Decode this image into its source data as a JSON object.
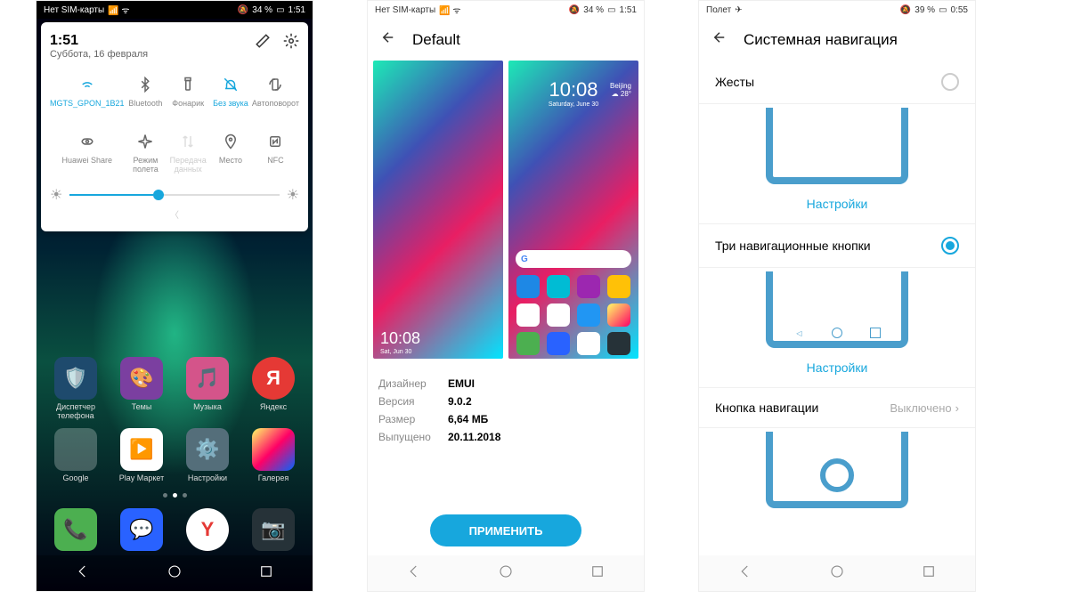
{
  "phone1": {
    "status": {
      "left": "Нет SIM-карты",
      "battery": "34 %",
      "time": "1:51"
    },
    "qs": {
      "time": "1:51",
      "date": "Суббота, 16 февраля",
      "tiles": [
        {
          "label": "MGTS_GPON_1B21",
          "state": "active"
        },
        {
          "label": "Bluetooth",
          "state": ""
        },
        {
          "label": "Фонарик",
          "state": ""
        },
        {
          "label": "Без звука",
          "state": "active"
        },
        {
          "label": "Автоповорот",
          "state": ""
        },
        {
          "label": "Huawei Share",
          "state": ""
        },
        {
          "label": "Режим полета",
          "state": ""
        },
        {
          "label": "Передача данных",
          "state": "dis"
        },
        {
          "label": "Место",
          "state": ""
        },
        {
          "label": "NFC",
          "state": ""
        }
      ]
    },
    "apps_r1": [
      "Диспетчер телефона",
      "Темы",
      "Музыка",
      "Яндекс"
    ],
    "apps_r2": [
      "Google",
      "Play Маркет",
      "Настройки",
      "Галерея"
    ]
  },
  "phone2": {
    "status": {
      "left": "Нет SIM-карты",
      "battery": "34 %",
      "time": "1:51"
    },
    "title": "Default",
    "lock_time": "10:08",
    "lock_date": "Sat, Jun 30",
    "home_time": "10:08",
    "home_date": "Saturday, June 30",
    "home_city": "Beijing",
    "home_temp": "28°",
    "info": {
      "designer_k": "Дизайнер",
      "designer_v": "EMUI",
      "version_k": "Версия",
      "version_v": "9.0.2",
      "size_k": "Размер",
      "size_v": "6,64 МБ",
      "released_k": "Выпущено",
      "released_v": "20.11.2018"
    },
    "apply": "ПРИМЕНИТЬ"
  },
  "phone3": {
    "status": {
      "left": "Полет",
      "battery": "39 %",
      "time": "0:55"
    },
    "title": "Системная навигация",
    "opt1": "Жесты",
    "opt2": "Три навигационные кнопки",
    "opt3": "Кнопка навигации",
    "opt3_val": "Выключено",
    "settings": "Настройки"
  }
}
